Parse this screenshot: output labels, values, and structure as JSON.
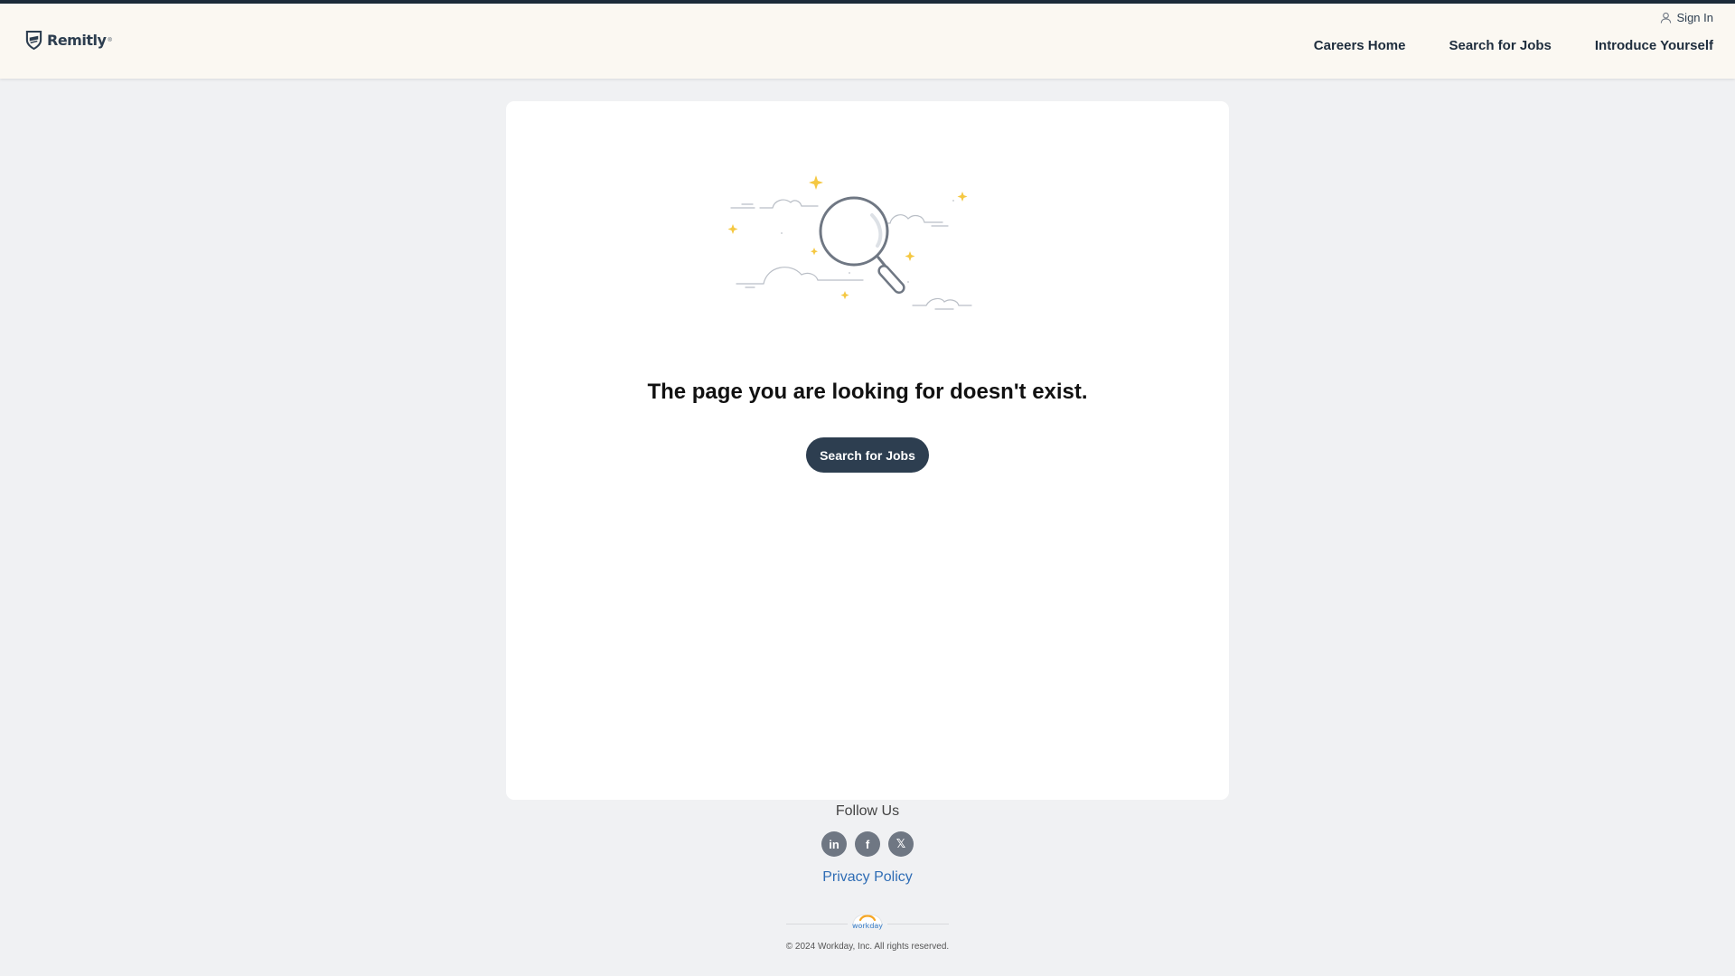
{
  "header": {
    "logo_text": "Remitly",
    "logo_tm": "®",
    "signin_label": "Sign In",
    "nav": [
      {
        "label": "Careers Home"
      },
      {
        "label": "Search for Jobs"
      },
      {
        "label": "Introduce Yourself"
      }
    ]
  },
  "main": {
    "headline": "The page you are looking for doesn't exist.",
    "button_label": "Search for Jobs"
  },
  "footer": {
    "follow_label": "Follow Us",
    "social": [
      {
        "name": "linkedin-icon",
        "glyph": "in"
      },
      {
        "name": "facebook-icon",
        "glyph": "f"
      },
      {
        "name": "x-icon",
        "glyph": "𝕏"
      }
    ],
    "privacy_label": "Privacy Policy",
    "powered_by": "workday",
    "copyright": "© 2024 Workday, Inc. All rights reserved."
  },
  "colors": {
    "header_bg": "#fbf8f2",
    "top_line": "#1c2b3a",
    "page_bg": "#f0f1f3",
    "primary": "#2d3e50",
    "link": "#2f6db5",
    "sparkle": "#f5c842"
  }
}
